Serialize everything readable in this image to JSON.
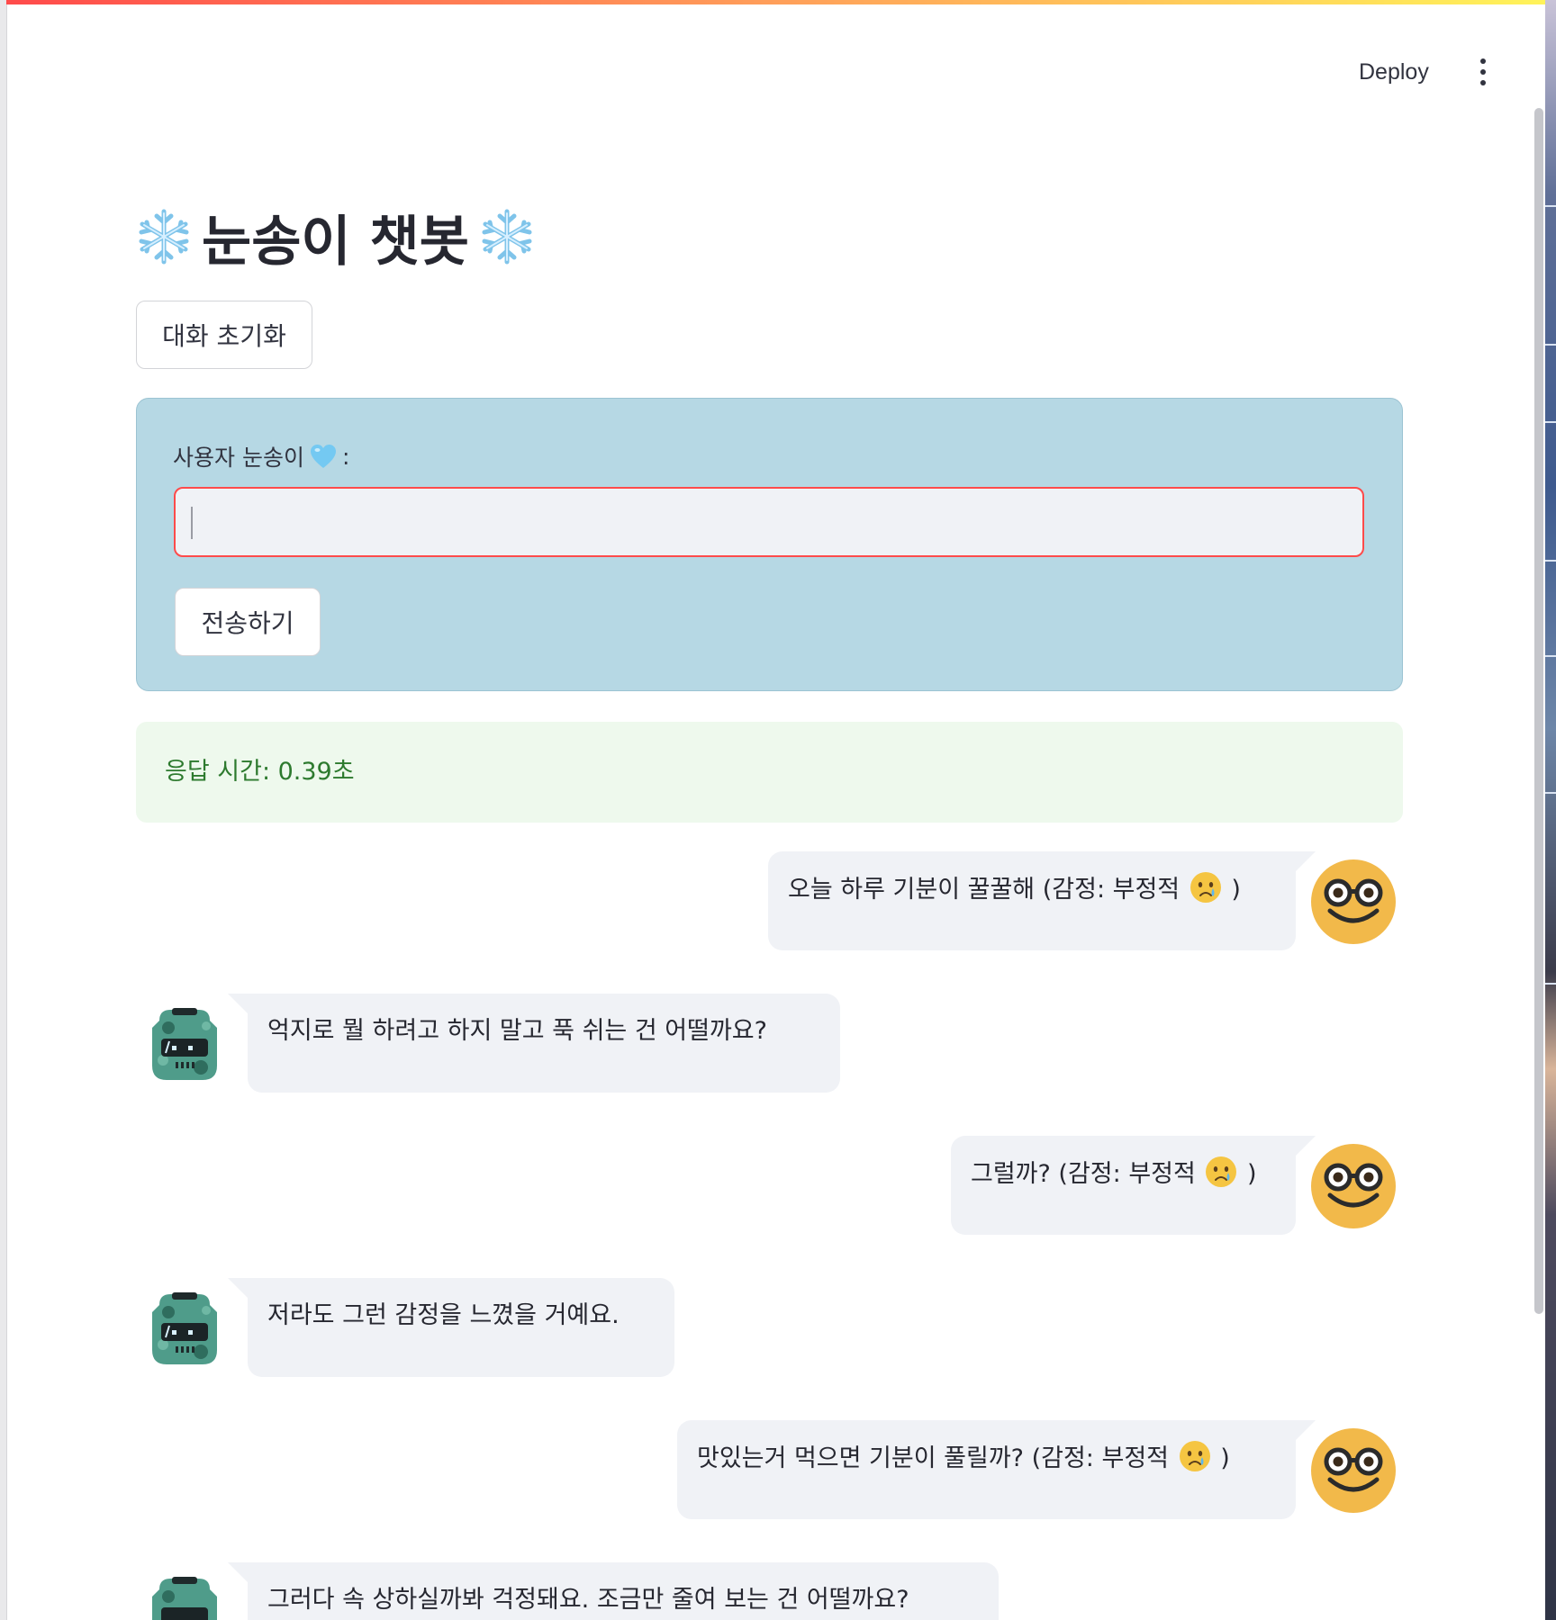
{
  "header": {
    "deploy_label": "Deploy",
    "menu_icon": "more-vertical-icon"
  },
  "title": {
    "text": "눈송이 챗봇",
    "icon": "snowflake-icon"
  },
  "reset_button": {
    "label": "대화 초기화"
  },
  "form": {
    "label": "사용자 눈송이",
    "label_suffix": ":",
    "label_icon": "light-blue-heart-icon",
    "input_value": "",
    "submit_label": "전송하기",
    "input_border_color": "#ff4b4b",
    "background_color": "#b6d8e4"
  },
  "status": {
    "text": "응답 시간: 0.39초",
    "color": "#2d7a2e"
  },
  "messages": [
    {
      "role": "user",
      "text": "오늘 하루 기분이 꿀꿀해 (감정: 부정적",
      "emotion_icon": "crying-face-icon",
      "close": ")"
    },
    {
      "role": "bot",
      "text": "억지로 뭘 하려고 하지 말고 푹 쉬는 건 어떨까요?"
    },
    {
      "role": "user",
      "text": "그럴까? (감정: 부정적",
      "emotion_icon": "crying-face-icon",
      "close": ")"
    },
    {
      "role": "bot",
      "text": "저라도 그런 감정을 느꼈을 거예요."
    },
    {
      "role": "user",
      "text": "맛있는거 먹으면 기분이 풀릴까? (감정: 부정적",
      "emotion_icon": "crying-face-icon",
      "close": ")"
    },
    {
      "role": "bot",
      "text": "그러다 속 상하실까봐 걱정돼요. 조금만 줄여 보는 건 어떨까요?"
    }
  ],
  "avatars": {
    "user": "nerd-face-icon",
    "bot": "robot-avatar-icon"
  }
}
